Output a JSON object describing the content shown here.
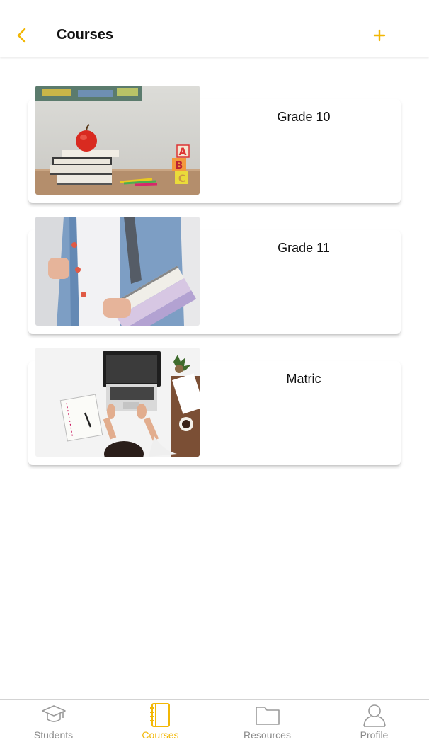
{
  "header": {
    "title": "Courses",
    "back_icon": "chevron-left-icon",
    "add_icon": "plus-icon",
    "accent_color": "#f2b705"
  },
  "courses": [
    {
      "title": "Grade 10",
      "image": "apple-on-books-photo"
    },
    {
      "title": "Grade 11",
      "image": "student-holding-binders-photo"
    },
    {
      "title": "Matric",
      "image": "desk-with-laptop-photo"
    }
  ],
  "bottom_nav": {
    "active_color": "#f2b705",
    "inactive_color": "#8a8a8a",
    "items": [
      {
        "label": "Students",
        "icon": "graduation-cap-icon",
        "active": false
      },
      {
        "label": "Courses",
        "icon": "notebook-icon",
        "active": true
      },
      {
        "label": "Resources",
        "icon": "folder-icon",
        "active": false
      },
      {
        "label": "Profile",
        "icon": "user-icon",
        "active": false
      }
    ]
  }
}
